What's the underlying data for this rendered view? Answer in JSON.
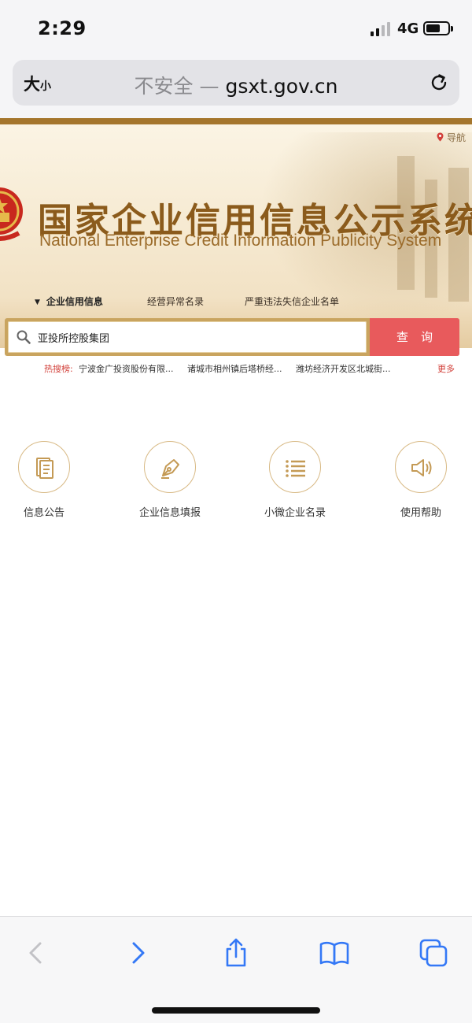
{
  "status_bar": {
    "time": "2:29",
    "network": "4G"
  },
  "browser": {
    "text_size_big": "大",
    "text_size_small": "小",
    "url_insecure": "不安全 — ",
    "url_domain": "gsxt.gov.cn"
  },
  "site": {
    "nav_link": "导航",
    "title_cn": "国家企业信用信息公示系统",
    "title_en": "National Enterprise Credit Information Publicity System",
    "tabs": [
      {
        "label": "企业信用信息",
        "active": true
      },
      {
        "label": "经营异常名录",
        "active": false
      },
      {
        "label": "严重违法失信企业名单",
        "active": false
      }
    ]
  },
  "search": {
    "value": "亚投所控股集团",
    "button_label": "查询"
  },
  "hot_search": {
    "label": "热搜榜:",
    "items": [
      "宁波金广投资股份有限...",
      "诸城市相州镇后塔桥经...",
      "潍坊经济开发区北城街..."
    ],
    "more": "更多"
  },
  "features": [
    {
      "label": "信息公告",
      "icon": "document-icon"
    },
    {
      "label": "企业信息填报",
      "icon": "pen-icon"
    },
    {
      "label": "小微企业名录",
      "icon": "list-icon"
    },
    {
      "label": "使用帮助",
      "icon": "speaker-icon"
    }
  ],
  "colors": {
    "brand_brown": "#8b5b1c",
    "gold": "#c9a45f",
    "search_red": "#e85a5c",
    "hot_red": "#d2403a",
    "ios_blue": "#3478f6"
  }
}
